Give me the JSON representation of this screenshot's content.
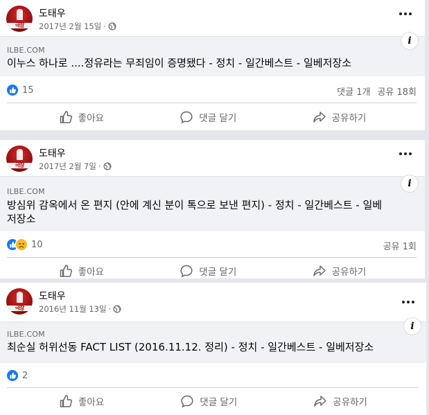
{
  "posts": [
    {
      "author": "도태우",
      "date": "2017년 2월 15일",
      "domain": "ILBE.COM",
      "title": "이누스 하나로 ....정유라는 무죄임이 증명됐다 - 정치 - 일간베스트 - 일베저장소",
      "reaction_count": "15",
      "comments": "댓글 1개",
      "shares": "공유 18회",
      "like_label": "좋아요",
      "comment_label": "댓글 달기",
      "share_label": "공유하기"
    },
    {
      "author": "도태우",
      "date": "2017년 2월 7일",
      "domain": "ILBE.COM",
      "title_line1": "방심위 감옥에서 온 편지 (안에 계신 분이 톡으로 보낸 편지) - 정치 - 일간베스트 - 일베",
      "title_line2": "저장소",
      "reaction_count": "10",
      "shares": "공유 1회",
      "like_label": "좋아요",
      "comment_label": "댓글 달기",
      "share_label": "공유하기"
    },
    {
      "author": "도태우",
      "date": "2016년 11월 13일",
      "domain": "ILBE.COM",
      "title": "최순실 허위선동 FACT LIST (2016.11.12. 정리) - 정치 - 일간베스트 - 일베저장소",
      "reaction_count": "2",
      "like_label": "좋아요",
      "comment_label": "댓글 달기",
      "share_label": "공유하기"
    }
  ],
  "avatar_text": "극장",
  "meta_separator": "·",
  "icons": {
    "globe": "globe-icon",
    "more": "more-options-icon",
    "info": "info-icon",
    "like": "thumbs-up-icon",
    "sad": "sad-face-icon",
    "comment": "comment-bubble-icon",
    "share": "share-arrow-icon"
  },
  "colors": {
    "like_blue": "#1877f2",
    "sad_yellow": "#f7b928",
    "secondary_text": "#65676b",
    "link_box_bg": "#f0f2f5"
  }
}
